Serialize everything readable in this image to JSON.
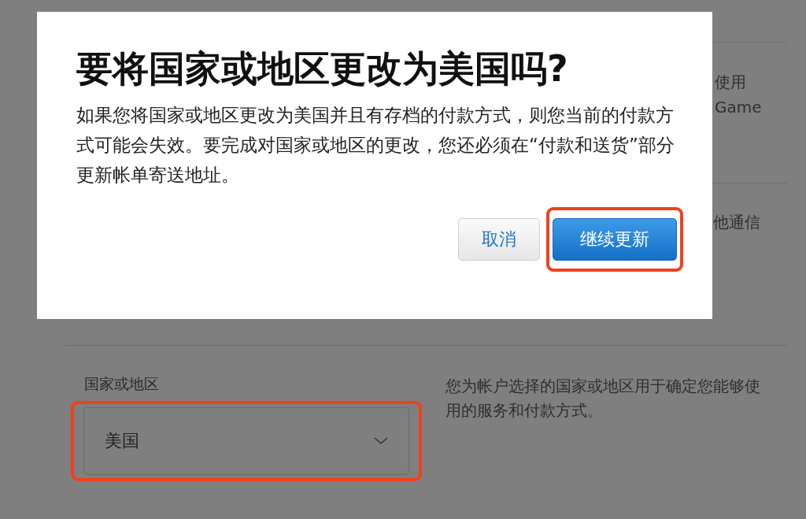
{
  "background": {
    "side_texts": [
      {
        "text": "使用",
        "kind": "indent"
      },
      {
        "text": "Game",
        "kind": "indent"
      },
      {
        "text": "他通信",
        "kind": "plain"
      }
    ],
    "country": {
      "label": "国家或地区",
      "value": "美国",
      "highlighted": true
    },
    "description": "您为帐户选择的国家或地区用于确定您能够使用的服务和付款方式。"
  },
  "dialog": {
    "title": "要将国家或地区更改为美国吗?",
    "message": "如果您将国家或地区更改为美国并且有存档的付款方式，则您当前的付款方式可能会失效。要完成对国家或地区的更改，您还必须在“付款和送货”部分更新帐单寄送地址。",
    "buttons": [
      {
        "label": "取消",
        "kind": "secondary",
        "highlighted": false
      },
      {
        "label": "继续更新",
        "kind": "primary",
        "highlighted": true
      }
    ]
  }
}
